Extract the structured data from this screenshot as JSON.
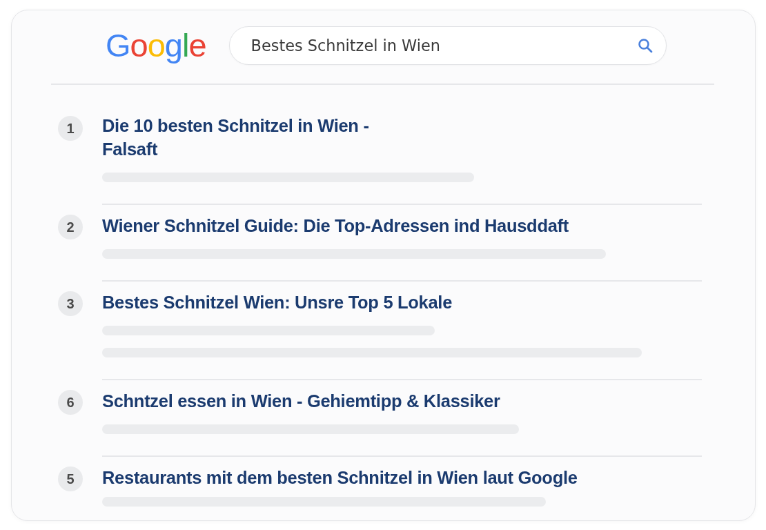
{
  "header": {
    "logo": "Google",
    "search": {
      "value": "Bestes Schnitzel in Wien"
    }
  },
  "results": [
    {
      "number": "1",
      "title": "Die 10 besten Schnitzel in Wien -\nFalsaft",
      "snippet_lines": [
        {
          "level": 0.62
        }
      ]
    },
    {
      "number": "2",
      "title": "Wiener Schnitzel Guide: Die Top-Adressen ind Hausddaft",
      "snippet_lines": [
        {
          "level": 0.84
        }
      ]
    },
    {
      "number": "3",
      "title": "Bestes Schnitzel Wien: Unsre Top 5 Lokale",
      "snippet_lines": [
        {
          "level": 0.555
        },
        {
          "level": 0.9
        }
      ]
    },
    {
      "number": "6",
      "title": "Schntzel essen in Wien - Gehiemtipp & Klassiker",
      "snippet_lines": [
        {
          "level": 0.695
        }
      ]
    },
    {
      "number": "5",
      "title": "Restaurants mit dem besten Schnitzel in Wien laut Google",
      "snippet_lines": [
        {
          "level": 0.74
        }
      ]
    }
  ]
}
